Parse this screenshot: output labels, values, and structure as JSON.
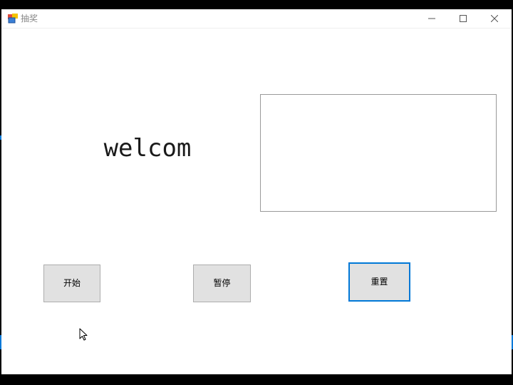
{
  "window": {
    "title": "抽奖",
    "app_icon": "winforms-app-icon",
    "controls": {
      "minimize_icon": "minimize-icon",
      "maximize_icon": "maximize-icon",
      "close_icon": "close-icon"
    }
  },
  "main": {
    "welcome_text": "welcom",
    "result_box": {
      "value": ""
    },
    "buttons": {
      "start_label": "开始",
      "pause_label": "暂停",
      "reset_label": "重置"
    }
  },
  "colors": {
    "window_bg": "#ffffff",
    "button_bg": "#e1e1e1",
    "button_border": "#adadad",
    "focus_accent": "#0078d7",
    "title_text": "#888888"
  }
}
